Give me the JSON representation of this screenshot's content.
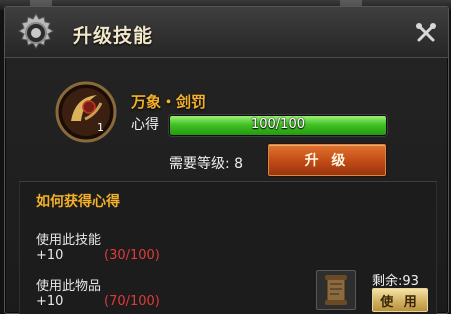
{
  "window": {
    "title": "升级技能"
  },
  "skill": {
    "name": "万象・剑罚",
    "level": "1",
    "xp_label": "心得",
    "xp_text": "100/100",
    "xp_fraction": 1.0,
    "required_level_label": "需要等级:",
    "required_level": "8",
    "upgrade_label": "升 级"
  },
  "how_to_get": {
    "title": "如何获得心得",
    "sources": [
      {
        "name": "使用此技能",
        "gain": "+10",
        "progress": "(30/100)"
      },
      {
        "name": "使用此物品",
        "gain": "+10",
        "progress": "(70/100)"
      }
    ],
    "item": {
      "remaining": "剩余:93",
      "use_label": "使 用",
      "icon": "scroll-item-icon"
    }
  },
  "colors": {
    "accent_gold": "#f3b02a",
    "progress_red": "#e23a3a",
    "xp_green": "#42c224",
    "upgrade_orange": "#c04a16"
  }
}
